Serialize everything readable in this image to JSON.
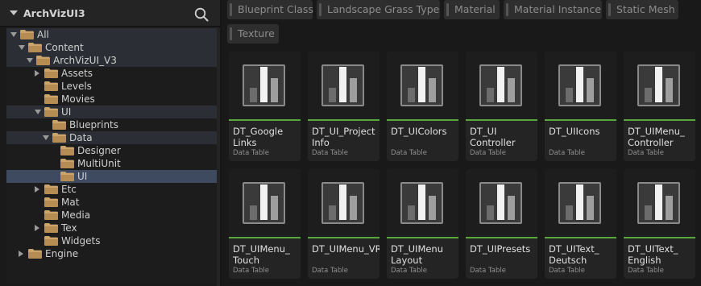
{
  "sidebar": {
    "title": "ArchVizUI3",
    "tree": [
      {
        "label": "All"
      },
      {
        "label": "Content"
      },
      {
        "label": "ArchVizUI_V3"
      },
      {
        "label": "Assets"
      },
      {
        "label": "Levels"
      },
      {
        "label": "Movies"
      },
      {
        "label": "UI"
      },
      {
        "label": "Blueprints"
      },
      {
        "label": "Data"
      },
      {
        "label": "Designer"
      },
      {
        "label": "MultiUnit"
      },
      {
        "label": "UI"
      },
      {
        "label": "Etc"
      },
      {
        "label": "Mat"
      },
      {
        "label": "Media"
      },
      {
        "label": "Tex"
      },
      {
        "label": "Widgets"
      },
      {
        "label": "Engine"
      }
    ]
  },
  "filters": [
    {
      "label": "Blueprint Class"
    },
    {
      "label": "Landscape Grass Type"
    },
    {
      "label": "Material"
    },
    {
      "label": "Material Instance"
    },
    {
      "label": "Static Mesh"
    },
    {
      "label": "Texture"
    }
  ],
  "assets": [
    {
      "name": "DT_Google Links",
      "type": "Data Table"
    },
    {
      "name": "DT_UI_Project Info",
      "type": "Data Table"
    },
    {
      "name": "DT_UIColors",
      "type": "Data Table"
    },
    {
      "name": "DT_UI Controller",
      "type": "Data Table"
    },
    {
      "name": "DT_UIIcons",
      "type": "Data Table"
    },
    {
      "name": "DT_UIMenu_ Controller",
      "type": "Data Table"
    },
    {
      "name": "DT_UIMenu_ Touch",
      "type": "Data Table"
    },
    {
      "name": "DT_UIMenu_VR",
      "type": "Data Table"
    },
    {
      "name": "DT_UIMenu Layout",
      "type": "Data Table"
    },
    {
      "name": "DT_UIPresets",
      "type": "Data Table"
    },
    {
      "name": "DT_UIText_ Deutsch",
      "type": "Data Table"
    },
    {
      "name": "DT_UIText_ English",
      "type": "Data Table"
    }
  ],
  "colors": {
    "accent_green": "#57a73c",
    "selection": "#3d4a60",
    "folder": "#c9a46b"
  }
}
